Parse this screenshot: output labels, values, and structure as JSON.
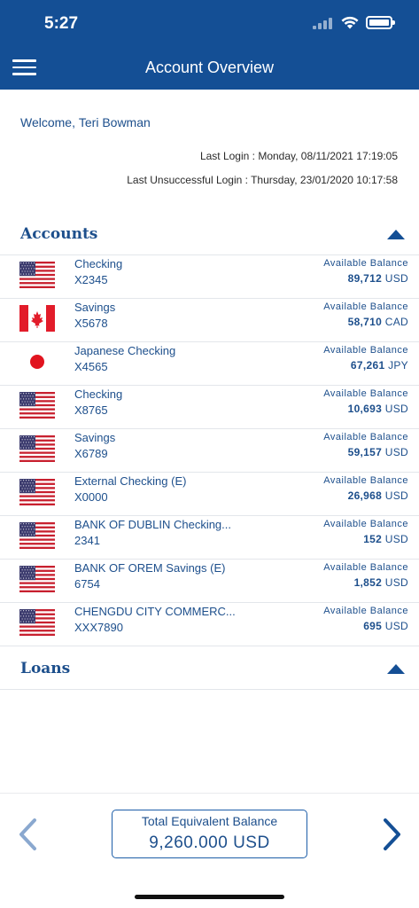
{
  "status_bar": {
    "time": "5:27"
  },
  "header": {
    "title": "Account Overview"
  },
  "welcome": {
    "prefix": "Welcome,",
    "name": "Teri Bowman"
  },
  "last_login": "Last Login : Monday, 08/11/2021 17:19:05",
  "last_unsuccessful_login": "Last Unsuccessful Login : Thursday, 23/01/2020 10:17:58",
  "sections": {
    "accounts": {
      "title": "Accounts"
    },
    "loans": {
      "title": "Loans"
    }
  },
  "accounts": [
    {
      "flag": "us-flag",
      "name": "Checking",
      "number": "X2345",
      "balance_label": "Available Balance",
      "balance": "89,712",
      "currency": "USD"
    },
    {
      "flag": "canada-flag",
      "name": "Savings",
      "number": "X5678",
      "balance_label": "Available Balance",
      "balance": "58,710",
      "currency": "CAD"
    },
    {
      "flag": "japan-flag",
      "name": "Japanese Checking",
      "number": "X4565",
      "balance_label": "Available Balance",
      "balance": "67,261",
      "currency": "JPY"
    },
    {
      "flag": "us-flag",
      "name": "Checking",
      "number": "X8765",
      "balance_label": "Available Balance",
      "balance": "10,693",
      "currency": "USD"
    },
    {
      "flag": "us-flag",
      "name": "Savings",
      "number": "X6789",
      "balance_label": "Available Balance",
      "balance": "59,157",
      "currency": "USD"
    },
    {
      "flag": "us-flag",
      "name": "External Checking (E)",
      "number": "X0000",
      "balance_label": "Available Balance",
      "balance": "26,968",
      "currency": "USD"
    },
    {
      "flag": "us-flag",
      "name": "BANK OF DUBLIN Checking...",
      "number": "2341",
      "balance_label": "Available Balance",
      "balance": "152",
      "currency": "USD"
    },
    {
      "flag": "us-flag",
      "name": "BANK OF OREM Savings (E)",
      "number": "6754",
      "balance_label": "Available Balance",
      "balance": "1,852",
      "currency": "USD"
    },
    {
      "flag": "us-flag",
      "name": "CHENGDU CITY COMMERC...",
      "number": "XXX7890",
      "balance_label": "Available Balance",
      "balance": "695",
      "currency": "USD"
    }
  ],
  "footer": {
    "total_label": "Total Equivalent Balance",
    "total_value": "9,260.000 USD",
    "prev_icon": "chevron-left-icon",
    "next_icon": "chevron-right-icon"
  },
  "colors": {
    "header_bg": "#144f95",
    "text_primary": "#1d4f8c",
    "divider": "#e3e6eb"
  }
}
